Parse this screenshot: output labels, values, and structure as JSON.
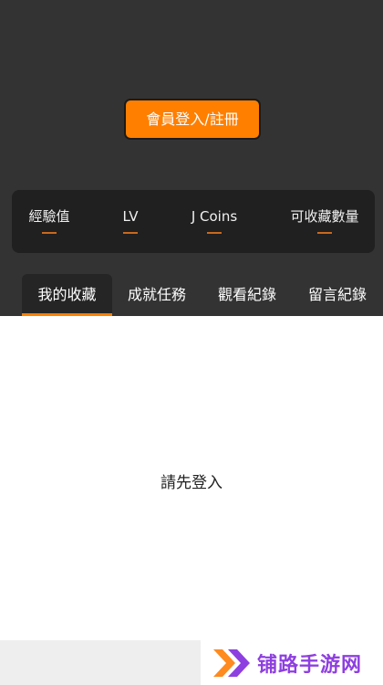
{
  "header": {
    "login_button_label": "會員登入/註冊"
  },
  "stats": [
    {
      "label": "經驗值",
      "value": "---"
    },
    {
      "label": "LV",
      "value": "---"
    },
    {
      "label": "J Coins",
      "value": "---"
    },
    {
      "label": "可收藏數量",
      "value": "---"
    }
  ],
  "tabs": [
    {
      "label": "我的收藏",
      "active": true
    },
    {
      "label": "成就任務",
      "active": false
    },
    {
      "label": "觀看紀錄",
      "active": false
    },
    {
      "label": "留言紀錄",
      "active": false
    }
  ],
  "content": {
    "message": "請先登入"
  },
  "watermark": {
    "text": "铺路手游网"
  },
  "colors": {
    "accent": "#ff7f00",
    "header_bg": "#333333",
    "card_bg": "#202020",
    "watermark": "#8e3fe0"
  }
}
